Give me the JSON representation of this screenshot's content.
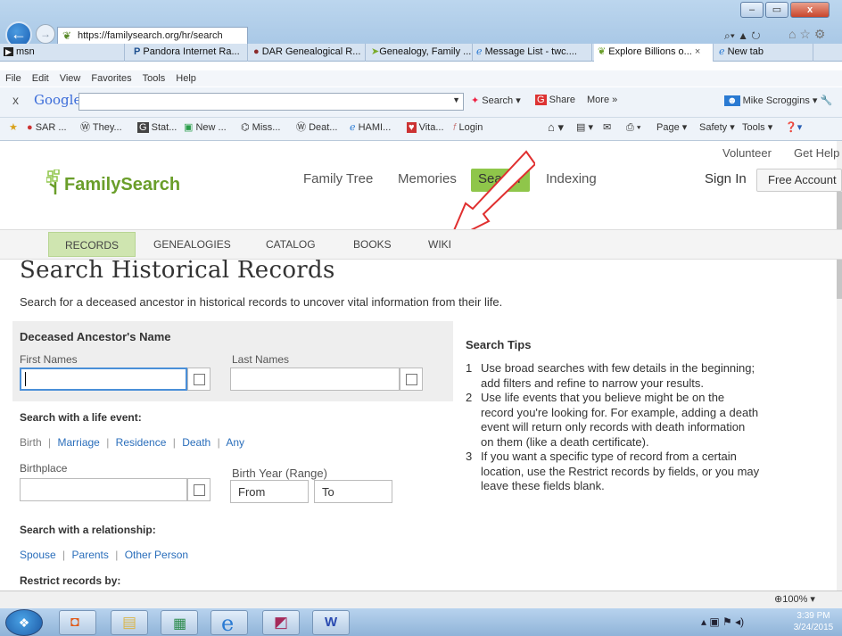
{
  "browser": {
    "url": "https://familysearch.org/hr/search",
    "tabs": [
      {
        "label": "msn"
      },
      {
        "label": "Pandora Internet Ra..."
      },
      {
        "label": "DAR Genealogical R..."
      },
      {
        "label": "Genealogy, Family ..."
      },
      {
        "label": "Message List - twc...."
      },
      {
        "label": "Explore Billions o...",
        "active": true
      },
      {
        "label": "New tab"
      }
    ],
    "menu": [
      "File",
      "Edit",
      "View",
      "Favorites",
      "Tools",
      "Help"
    ],
    "google_bar": {
      "logo": "Google",
      "search_label": "Search",
      "share_label": "Share",
      "more_label": "More »",
      "user": "Mike Scroggins"
    },
    "favorites": [
      "SAR ...",
      "They...",
      "Stat...",
      "New ...",
      "Miss...",
      "Deat...",
      "HAMI...",
      "Vita...",
      "Login"
    ],
    "command_bar": [
      "Page",
      "Safety",
      "Tools"
    ],
    "zoom": "100%"
  },
  "site": {
    "logo": "FamilySearch",
    "top_links": [
      "Volunteer",
      "Get Help"
    ],
    "nav": [
      "Family Tree",
      "Memories",
      "Search",
      "Indexing"
    ],
    "sign_in": "Sign In",
    "free_account": "Free Account",
    "subnav": [
      "RECORDS",
      "GENEALOGIES",
      "CATALOG",
      "BOOKS",
      "WIKI"
    ]
  },
  "main": {
    "title": "Search Historical Records",
    "description": "Search for a deceased ancestor in historical records to uncover vital information from their life.",
    "name_section": "Deceased Ancestor's Name",
    "first_names_label": "First Names",
    "last_names_label": "Last Names",
    "life_event_heading": "Search with a life event:",
    "life_events": [
      "Birth",
      "Marriage",
      "Residence",
      "Death",
      "Any"
    ],
    "birthplace_label": "Birthplace",
    "birth_year_label": "Birth Year (Range)",
    "from_placeholder": "From",
    "to_placeholder": "To",
    "relationship_heading": "Search with a relationship:",
    "relationships": [
      "Spouse",
      "Parents",
      "Other Person"
    ],
    "restrict_heading": "Restrict records by:"
  },
  "tips": {
    "heading": "Search Tips",
    "items": [
      "Use broad searches with few details in the beginning; add filters and refine to narrow your results.",
      "Use life events that you believe might be on the record you're looking for. For example, adding a death event will return only records with death information on them (like a death certificate).",
      "If you want a specific type of record from a certain location, use the Restrict records by fields, or you may leave these fields blank."
    ]
  },
  "taskbar": {
    "time": "3:39 PM",
    "date": "3/24/2015"
  }
}
